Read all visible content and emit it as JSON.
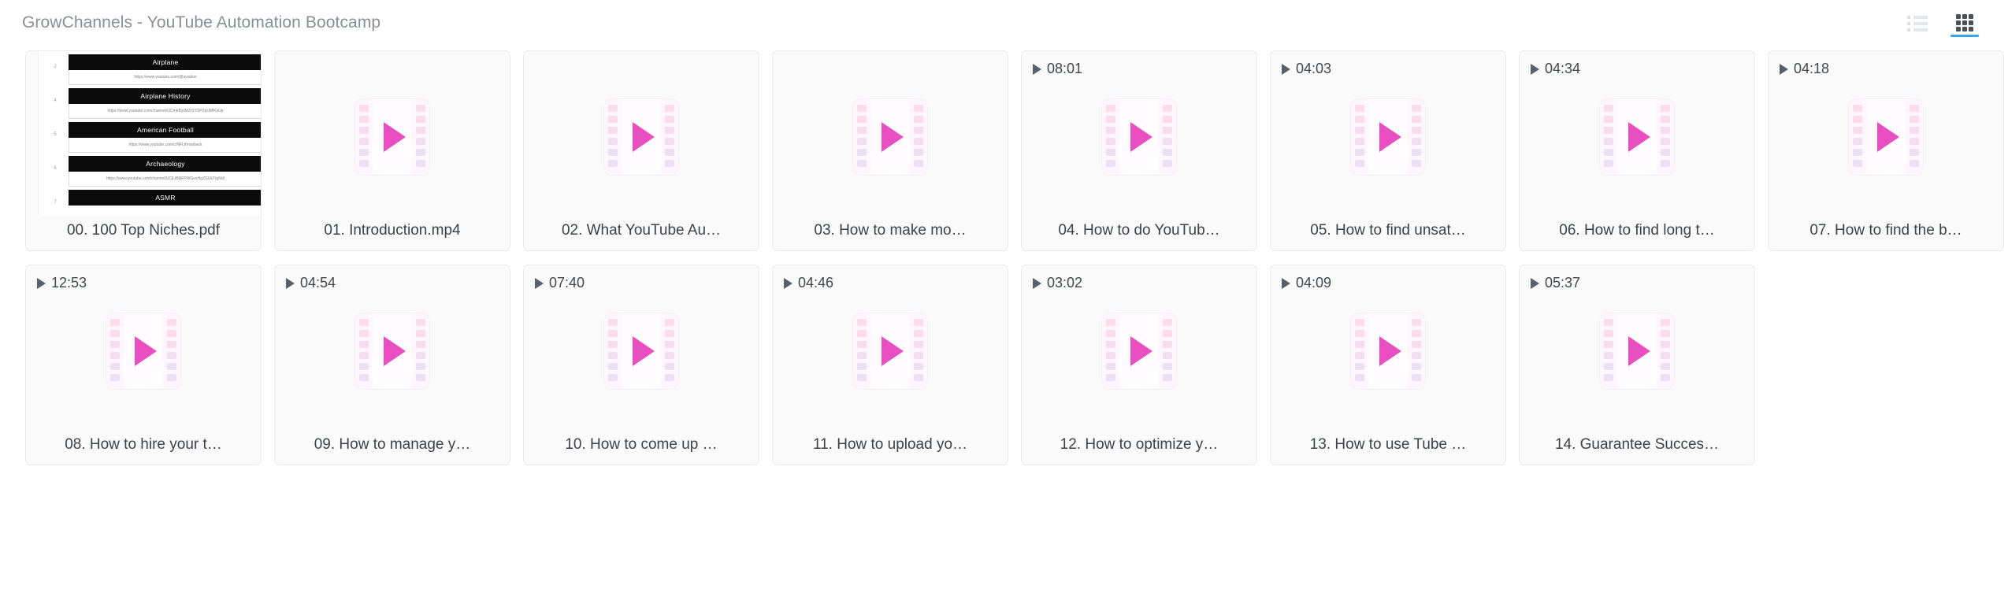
{
  "header": {
    "title": "GrowChannels - YouTube Automation Bootcamp",
    "list_view_icon": "list-view-icon",
    "grid_view_icon": "grid-view-icon",
    "active_view": "grid",
    "accent_color": "#3aa3e3"
  },
  "colors": {
    "card_bg": "#fafafa",
    "card_border": "#ebebeb",
    "label_text": "#3c4248",
    "title_text": "#8a8f94",
    "play_triangle": "#e94fc0",
    "duration_text": "#41474d"
  },
  "pdf_preview": {
    "rows": [
      {
        "num": "2",
        "name": "Airplane",
        "url": "https://www.youtube.com/@aviation"
      },
      {
        "num": "4",
        "name": "Airplane History",
        "url": "https://www.youtube.com/channel/UCmeByvMZiSYSPZpUMlKsUp"
      },
      {
        "num": "5",
        "name": "American Football",
        "url": "https://www.youtube.com/c/NFLthrowback"
      },
      {
        "num": "6",
        "name": "Archaeology",
        "url": "https://www.youtube.com/channel/UCjLtBNFPWGuxHgZGUkTtuNdI"
      },
      {
        "num": "7",
        "name": "ASMR",
        "url": ""
      }
    ]
  },
  "items": [
    {
      "type": "pdf",
      "label": "00. 100 Top Niches.pdf",
      "duration": ""
    },
    {
      "type": "video",
      "label": "01. Introduction.mp4",
      "duration": ""
    },
    {
      "type": "video",
      "label": "02. What YouTube Au…",
      "duration": ""
    },
    {
      "type": "video",
      "label": "03. How to make mo…",
      "duration": ""
    },
    {
      "type": "video",
      "label": "04. How to do YouTub…",
      "duration": "08:01"
    },
    {
      "type": "video",
      "label": "05. How to find unsat…",
      "duration": "04:03"
    },
    {
      "type": "video",
      "label": "06. How to find long t…",
      "duration": "04:34"
    },
    {
      "type": "video",
      "label": "07. How to find the b…",
      "duration": "04:18"
    },
    {
      "type": "video",
      "label": "08. How to hire your t…",
      "duration": "12:53"
    },
    {
      "type": "video",
      "label": "09. How to manage y…",
      "duration": "04:54"
    },
    {
      "type": "video",
      "label": "10. How to come up …",
      "duration": "07:40"
    },
    {
      "type": "video",
      "label": "11. How to upload yo…",
      "duration": "04:46"
    },
    {
      "type": "video",
      "label": "12. How to optimize y…",
      "duration": "03:02"
    },
    {
      "type": "video",
      "label": "13. How to use Tube …",
      "duration": "04:09"
    },
    {
      "type": "video",
      "label": "14. Guarantee Succes…",
      "duration": "05:37"
    }
  ]
}
